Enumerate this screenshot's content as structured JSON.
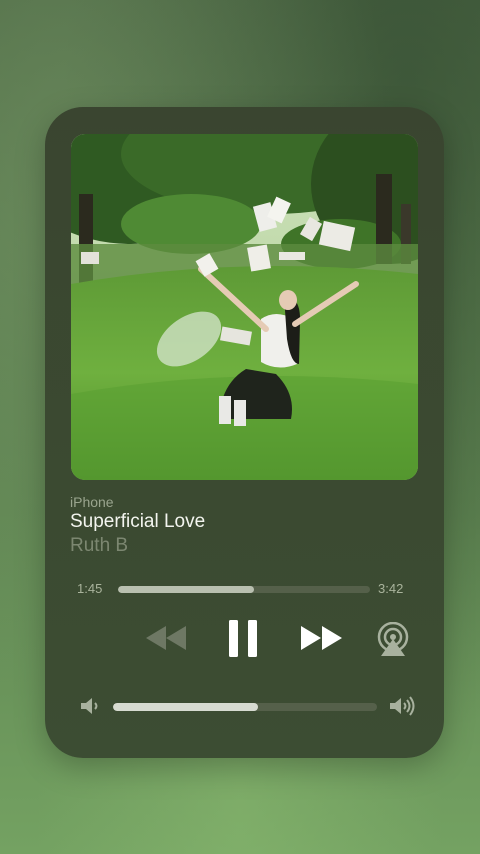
{
  "now_playing": {
    "device": "iPhone",
    "title": "Superficial Love",
    "artist": "Ruth B"
  },
  "progress": {
    "elapsed": "1:45",
    "remaining": "3:42",
    "fraction": 0.54
  },
  "volume": {
    "fraction": 0.55
  },
  "icons": {
    "rewind": "rewind-icon",
    "pause": "pause-icon",
    "fast_forward": "fast-forward-icon",
    "airplay": "airplay-icon",
    "volume_low": "volume-low-icon",
    "volume_high": "volume-high-icon"
  },
  "colors": {
    "card": "#3b4a31",
    "progress_fill": "#b9c0b0",
    "title": "#f3f5ef",
    "artist": "#7c8771"
  }
}
